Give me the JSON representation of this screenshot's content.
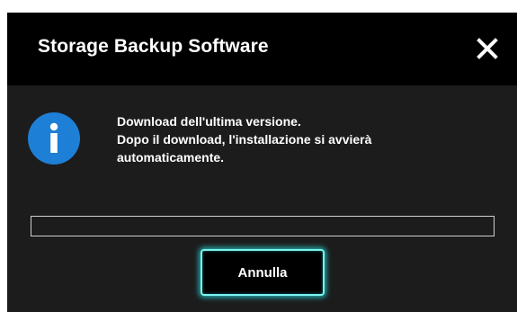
{
  "window": {
    "title": "Storage Backup Software"
  },
  "icons": {
    "close": "close-icon",
    "info": "info-icon"
  },
  "message": {
    "line1": "Download dell'ultima versione.",
    "line2": "Dopo il download, l'installazione si avvierà",
    "line3": "automaticamente."
  },
  "progress": {
    "fraction": 0.0
  },
  "buttons": {
    "cancel_label": "Annulla"
  },
  "colors": {
    "title_bar": "#000000",
    "body": "#1c1c1c",
    "info_icon": "#1e7fd6",
    "button_glow": "#7bf3ee"
  }
}
